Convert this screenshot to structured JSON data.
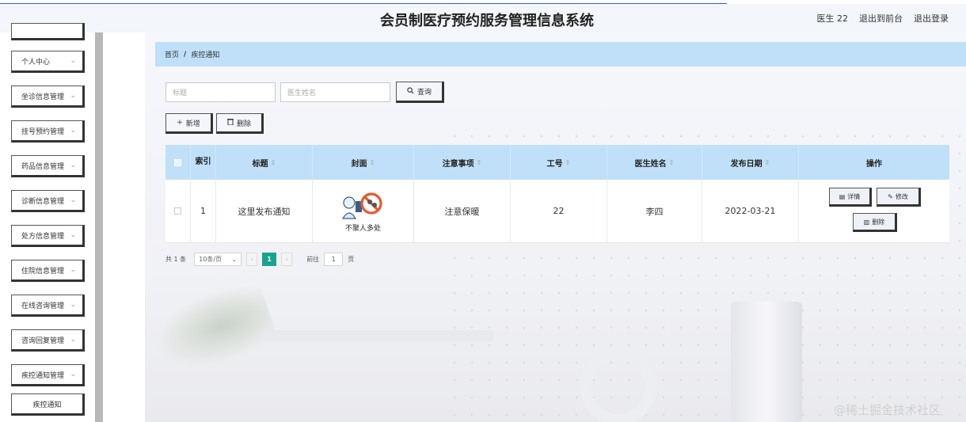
{
  "header": {
    "title": "会员制医疗预约服务管理信息系统",
    "user": "医生 22",
    "to_front": "退出到前台",
    "logout": "退出登录"
  },
  "sidebar": {
    "items": [
      {
        "label": "个人中心"
      },
      {
        "label": "坐诊信息管理"
      },
      {
        "label": "挂号预约管理"
      },
      {
        "label": "药品信息管理"
      },
      {
        "label": "诊断信息管理"
      },
      {
        "label": "处方信息管理"
      },
      {
        "label": "住院信息管理"
      },
      {
        "label": "在线咨询管理"
      },
      {
        "label": "咨询回复管理"
      },
      {
        "label": "疾控通知管理"
      }
    ],
    "sub_item": "疾控通知",
    "chevron": "⌄"
  },
  "breadcrumb": {
    "home": "首页",
    "sep": "/",
    "current": "疾控通知"
  },
  "search": {
    "title_placeholder": "标题",
    "doctor_placeholder": "医生姓名",
    "query_label": "查询"
  },
  "actions": {
    "add_label": "新增",
    "delete_label": "删除"
  },
  "table": {
    "headers": {
      "index": "索引",
      "title": "标题",
      "cover": "封面",
      "notes": "注意事项",
      "job_no": "工号",
      "doctor": "医生姓名",
      "date": "发布日期",
      "ops": "操作"
    },
    "row": {
      "index": "1",
      "title": "这里发布通知",
      "cover_caption": "不聚人多处",
      "notes": "注意保暖",
      "job_no": "22",
      "doctor": "李四",
      "date": "2022-03-21"
    },
    "op_labels": {
      "detail": "详情",
      "edit": "修改",
      "delete": "删除"
    }
  },
  "pager": {
    "total": "共 1 条",
    "size": "10条/页",
    "current": "1",
    "goto_label": "前往",
    "goto_value": "1",
    "page_suffix": "页"
  },
  "watermark": "@稀土掘金技术社区",
  "colors": {
    "accent": "#19a38e",
    "header_bg": "#bfe0f8"
  }
}
